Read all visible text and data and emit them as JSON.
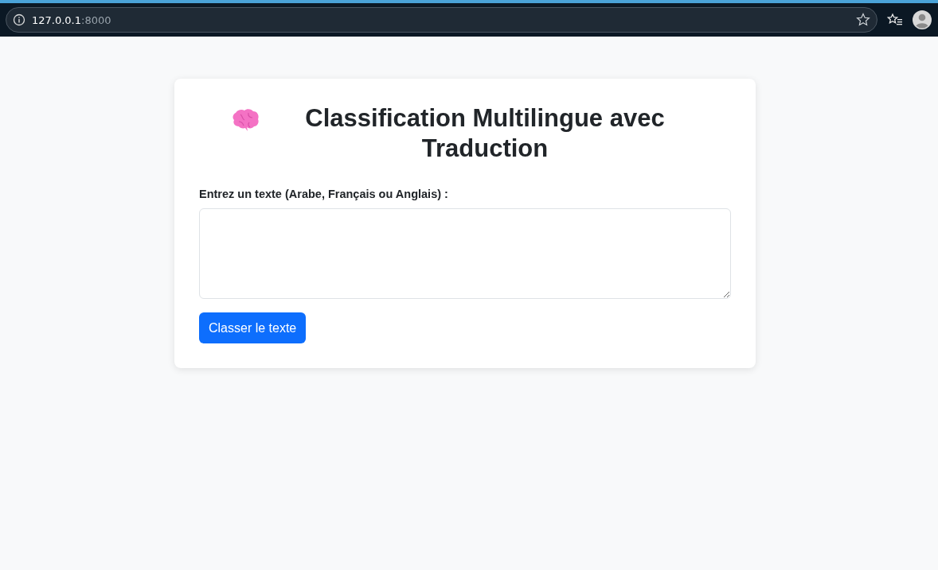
{
  "browser": {
    "address": {
      "host": "127.0.0.1",
      "port": ":8000"
    }
  },
  "card": {
    "title": "Classification Multilingue avec Traduction",
    "field": {
      "label": "Entrez un texte (Arabe, Français ou Anglais) :"
    },
    "button": "Classer le texte"
  }
}
